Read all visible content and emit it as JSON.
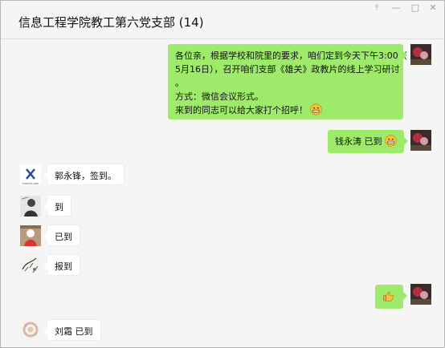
{
  "window": {
    "title": "信息工程学院教工第六党支部 (14)"
  },
  "messages": [
    {
      "sender": "me",
      "lines": [
        "各位亲，根据学校和院里的要求，咱们定到今天下午3:00（",
        "5月16日），召开咱们支部《雄关》政教片的线上学习研讨",
        "。",
        "方式：微信会议形式。",
        "来到的同志可以给大家打个招呼！"
      ],
      "emoji": "grin-emoji"
    },
    {
      "sender": "me",
      "text": "钱永涛 已到",
      "emoji": "grin-emoji"
    },
    {
      "sender": "other",
      "text": "郭永锋，签到。",
      "avatar_text": "huante.com"
    },
    {
      "sender": "other",
      "text": "到"
    },
    {
      "sender": "other",
      "text": "已到"
    },
    {
      "sender": "other",
      "text": "报到"
    },
    {
      "sender": "me",
      "emoji": "thumbs-up-emoji"
    },
    {
      "sender": "other",
      "text": "刘霜 已到"
    }
  ],
  "colors": {
    "my_bubble": "#9eea6a",
    "other_bubble": "#ffffff",
    "background": "#f5f5f5"
  }
}
